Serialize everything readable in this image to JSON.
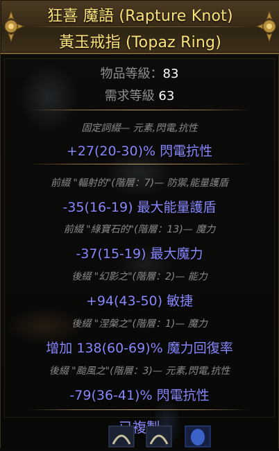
{
  "item": {
    "title_line1": "狂喜 魔語 (Rapture Knot)",
    "title_line2": "黃玉戒指 (Topaz Ring)"
  },
  "properties": {
    "item_level_label": "物品等級：",
    "item_level_value": "83",
    "req_level_label": "需求等級",
    "req_level_value": "63"
  },
  "implicit": {
    "header": "固定詞綴— 元素,閃電,抗性",
    "mod": "+27(20-30)% 閃電抗性"
  },
  "affixes": [
    {
      "header": "前綴 \"輻射的\"(階層：7)— 防禦,能量護盾",
      "mod": "-35(16-19) 最大能量護盾"
    },
    {
      "header": "前綴 \"綠寶石的\"(階層：13)— 魔力",
      "mod": "-37(15-19) 最大魔力"
    },
    {
      "header": "後綴 \"幻影之\"(階層：2)— 能力",
      "mod": "+94(43-50) 敏捷"
    },
    {
      "header": "後綴 \"涅槃之\"(階層：1)— 魔力",
      "mod": "增加 138(60-69)% 魔力回復率"
    },
    {
      "header": "後綴 \"颱風之\"(階層：3)— 元素,閃電,抗性",
      "mod": "-79(36-41)% 閃電抗性"
    }
  ],
  "status": {
    "mirrored": "已複製"
  },
  "colors": {
    "title": "#fbe27a",
    "magic_mod": "#8888ff",
    "separator": "#c9a45e"
  }
}
